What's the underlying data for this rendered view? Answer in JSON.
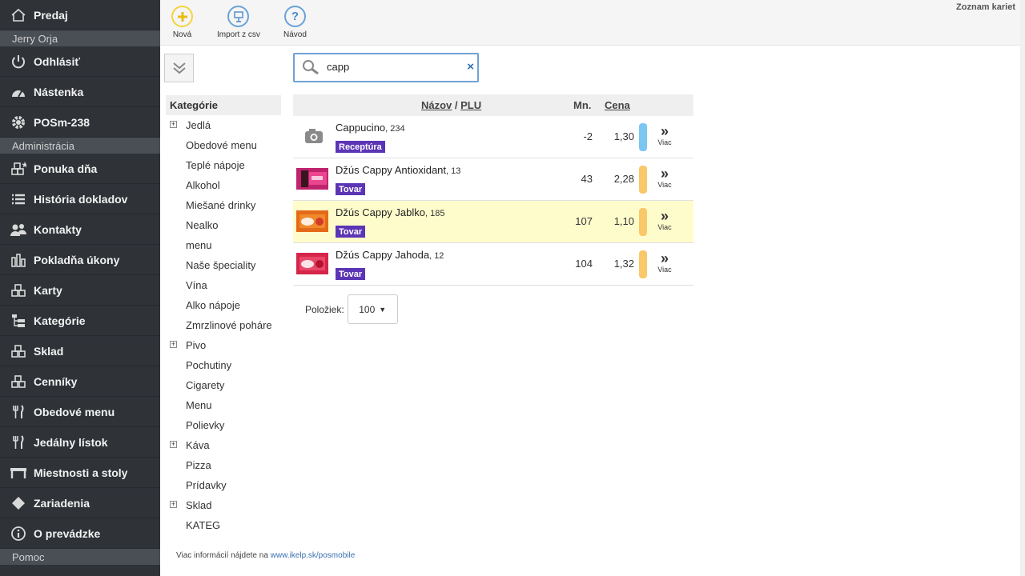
{
  "sidebar": {
    "top_item": {
      "label": "Predaj",
      "icon": "home-icon"
    },
    "user_name": "Jerry Orja",
    "items_a": [
      {
        "label": "Odhlásiť",
        "icon": "power-icon"
      },
      {
        "label": "Nástenka",
        "icon": "dashboard-icon"
      },
      {
        "label": "POSm-238",
        "icon": "gear-icon"
      }
    ],
    "section_admin": "Administrácia",
    "items_b": [
      {
        "label": "Ponuka dňa",
        "icon": "boxes-star-icon"
      },
      {
        "label": "História dokladov",
        "icon": "list-icon"
      },
      {
        "label": "Kontakty",
        "icon": "users-icon"
      },
      {
        "label": "Pokladňa úkony",
        "icon": "bar-chart-icon"
      },
      {
        "label": "Karty",
        "icon": "boxes-icon"
      },
      {
        "label": "Kategórie",
        "icon": "tree-icon"
      },
      {
        "label": "Sklad",
        "icon": "boxes-icon"
      },
      {
        "label": "Cenníky",
        "icon": "boxes-icon"
      },
      {
        "label": "Obedové menu",
        "icon": "cutlery-icon"
      },
      {
        "label": "Jedálny lístok",
        "icon": "cutlery-icon"
      },
      {
        "label": "Miestnosti a stoly",
        "icon": "table-icon"
      },
      {
        "label": "Zariadenia",
        "icon": "diamond-icon"
      },
      {
        "label": "O prevádzke",
        "icon": "info-icon"
      }
    ],
    "section_help": "Pomoc"
  },
  "toolbar": {
    "new_label": "Nová",
    "import_label": "Import z csv",
    "help_label": "Návod",
    "page_title": "Zoznam kariet"
  },
  "search": {
    "value": "capp",
    "clear": "×"
  },
  "categories": {
    "header": "Kategórie",
    "items": [
      {
        "label": "Jedlá",
        "expandable": true
      },
      {
        "label": "Obedové menu",
        "expandable": false
      },
      {
        "label": "Teplé nápoje",
        "expandable": false
      },
      {
        "label": "Alkohol",
        "expandable": false
      },
      {
        "label": "Miešané drinky",
        "expandable": false
      },
      {
        "label": "Nealko",
        "expandable": false
      },
      {
        "label": "menu",
        "expandable": false
      },
      {
        "label": "Naše špeciality",
        "expandable": false
      },
      {
        "label": "Vína",
        "expandable": false
      },
      {
        "label": "Alko nápoje",
        "expandable": false
      },
      {
        "label": "Zmrzlinové poháre",
        "expandable": false
      },
      {
        "label": "Pivo",
        "expandable": true
      },
      {
        "label": "Pochutiny",
        "expandable": false
      },
      {
        "label": "Cigarety",
        "expandable": false
      },
      {
        "label": "Menu",
        "expandable": false
      },
      {
        "label": "Polievky",
        "expandable": false
      },
      {
        "label": "Káva",
        "expandable": true
      },
      {
        "label": "Pizza",
        "expandable": false
      },
      {
        "label": "Prídavky",
        "expandable": false
      },
      {
        "label": "Sklad",
        "expandable": true
      },
      {
        "label": "KATEG",
        "expandable": false
      }
    ]
  },
  "grid": {
    "col_name": "Názov",
    "col_sep": " / ",
    "col_plu": "PLU",
    "col_qty": "Mn.",
    "col_price": "Cena",
    "more_label": "Viac",
    "rows": [
      {
        "name": "Cappucino",
        "plu": ", 234",
        "type": "Receptúra",
        "qty": "-2",
        "price": "1,30",
        "bar_color": "#7cc6f2",
        "thumb": "camera",
        "highlight": false
      },
      {
        "name": "Džús Cappy Antioxidant",
        "plu": ", 13",
        "type": "Tovar",
        "qty": "43",
        "price": "2,28",
        "bar_color": "#f9c86a",
        "thumb": "pink",
        "highlight": false
      },
      {
        "name": "Džús Cappy Jablko",
        "plu": ", 185",
        "type": "Tovar",
        "qty": "107",
        "price": "1,10",
        "bar_color": "#f9c86a",
        "thumb": "orange",
        "highlight": true
      },
      {
        "name": "Džús Cappy Jahoda",
        "plu": ", 12",
        "type": "Tovar",
        "qty": "104",
        "price": "1,32",
        "bar_color": "#f9c86a",
        "thumb": "red",
        "highlight": false
      }
    ]
  },
  "pager": {
    "label": "Položiek:",
    "value": "100"
  },
  "footer": {
    "text": "Viac informácií nájdete na ",
    "link": "www.ikelp.sk/posmobile"
  }
}
